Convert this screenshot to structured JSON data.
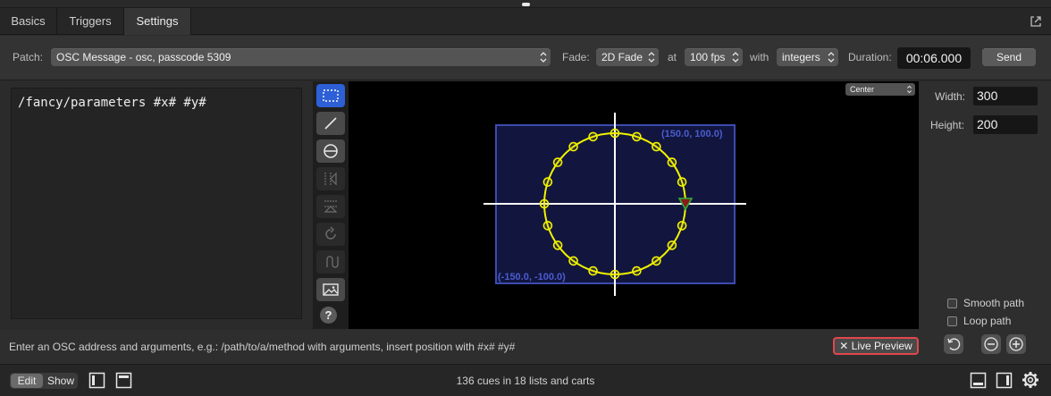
{
  "tabs": [
    {
      "label": "Basics",
      "active": false
    },
    {
      "label": "Triggers",
      "active": false
    },
    {
      "label": "Settings",
      "active": true
    }
  ],
  "toolbar": {
    "patch_label": "Patch:",
    "patch_value": "OSC Message - osc, passcode 5309",
    "fade_label": "Fade:",
    "fade_value": "2D Fade",
    "at_label": "at",
    "fps_value": "100 fps",
    "with_label": "with",
    "with_value": "integers",
    "duration_label": "Duration:",
    "duration_value": "00:06.000",
    "send_label": "Send"
  },
  "editor": {
    "text": "/fancy/parameters #x# #y#"
  },
  "preview": {
    "anchor_value": "Center",
    "corner_top_right": "(150.0, 100.0)",
    "corner_bottom_left": "(-150.0, -100.0)",
    "help_label": "?",
    "tools": [
      "select-rect-icon",
      "line-icon",
      "circle-icon",
      "flip-horizontal-icon",
      "flip-vertical-icon",
      "rotate-icon",
      "reverse-path-icon",
      "image-icon"
    ]
  },
  "side": {
    "width_label": "Width:",
    "width_value": "300",
    "height_label": "Height:",
    "height_value": "200",
    "smooth_label": "Smooth path",
    "smooth_checked": false,
    "loop_label": "Loop path",
    "loop_checked": false
  },
  "hint": {
    "text": "Enter an OSC address and arguments, e.g.: /path/to/a/method with arguments, insert position with #x# #y#",
    "live_preview_label": "✕ Live Preview"
  },
  "status": {
    "edit_label": "Edit",
    "show_label": "Show",
    "summary": "136 cues in 18 lists and carts"
  },
  "colors": {
    "accent": "#2d5fd6",
    "bounds_fill": "#12163f",
    "bounds_stroke": "#3c4bb0",
    "path": "#f2f200",
    "live_preview_border": "#e0474c"
  }
}
